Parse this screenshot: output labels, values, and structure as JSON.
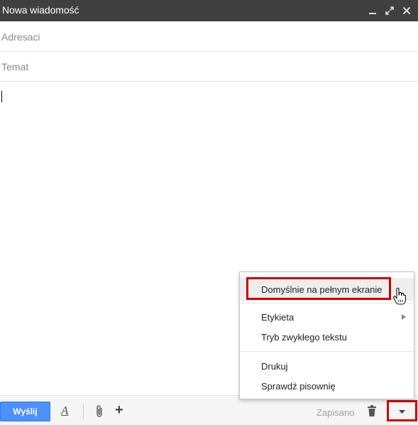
{
  "window": {
    "title": "Nowa wiadomość",
    "controls": [
      "minimize-icon",
      "expand-icon",
      "close-icon"
    ]
  },
  "compose": {
    "to_placeholder": "Adresaci",
    "to_value": "",
    "subject_placeholder": "Temat",
    "subject_value": "",
    "body_value": ""
  },
  "toolbar": {
    "send_label": "Wyślij",
    "formatting_icon": "text-format-icon",
    "attach_icon": "paperclip-icon",
    "more_icon": "plus-icon",
    "saved_label": "Zapisano",
    "delete_icon": "trash-icon",
    "options_icon": "dropdown-arrow-icon"
  },
  "menu": {
    "items": [
      {
        "label": "Domyślnie na pełnym ekranie",
        "hovered": true
      },
      {
        "label": "Etykieta",
        "has_submenu": true
      },
      {
        "label": "Tryb zwykłego tekstu"
      },
      {
        "label": "Drukuj"
      },
      {
        "label": "Sprawdź pisownię"
      }
    ]
  },
  "colors": {
    "titlebar": "#404040",
    "send_button": "#4d90fe",
    "highlight": "#cc0000"
  }
}
